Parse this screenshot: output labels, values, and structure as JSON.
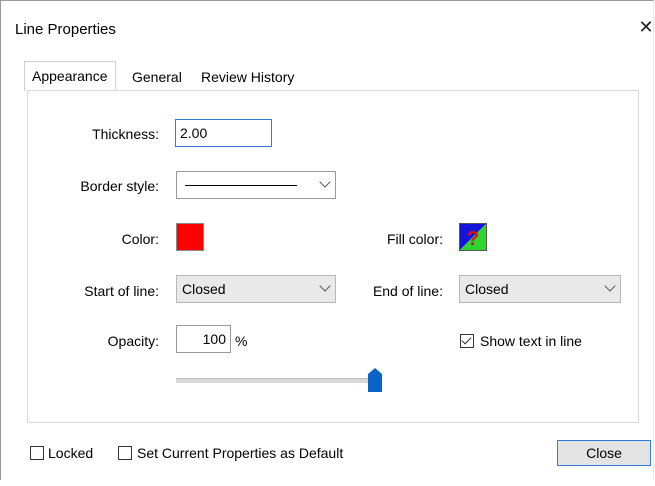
{
  "window": {
    "title": "Line Properties",
    "close_glyph": "✕"
  },
  "tabs": [
    {
      "label": "Appearance",
      "active": true
    },
    {
      "label": "General",
      "active": false
    },
    {
      "label": "Review History",
      "active": false
    }
  ],
  "appearance": {
    "thickness": {
      "label": "Thickness:",
      "value": "2.00"
    },
    "border_style": {
      "label": "Border style:",
      "value": "solid-line"
    },
    "color": {
      "label": "Color:",
      "value": "#ff0000"
    },
    "fill_color": {
      "label": "Fill color:",
      "value": "none",
      "glyph": "?"
    },
    "start_of_line": {
      "label": "Start of line:",
      "value": "Closed"
    },
    "end_of_line": {
      "label": "End of line:",
      "value": "Closed"
    },
    "opacity": {
      "label": "Opacity:",
      "value": "100",
      "unit": "%",
      "slider_fraction": 1.0
    },
    "show_text_in_line": {
      "label": "Show text in line",
      "checked": true
    }
  },
  "footer": {
    "locked": {
      "label": "Locked",
      "checked": false
    },
    "set_default": {
      "label": "Set Current Properties as Default",
      "checked": false
    },
    "close_button": "Close"
  },
  "colors": {
    "accent": "#2f7bd7",
    "slider_thumb": "#0a64c8",
    "color_swatch": "#ff0000"
  }
}
